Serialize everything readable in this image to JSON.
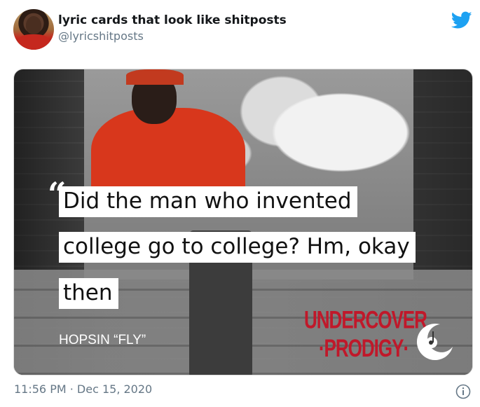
{
  "tweet": {
    "display_name": "lyric cards that look like shitposts",
    "handle": "@lyricshitposts",
    "timestamp": "11:56 PM · Dec 15, 2020",
    "brand_color": "#1da1f2"
  },
  "card": {
    "quote_mark": "“",
    "quote_lines": [
      "Did the man who invented",
      "college go to college? Hm, okay",
      "then"
    ],
    "credit": "HOPSIN “FLY”",
    "brand_line1": "UNDERCOVER",
    "brand_line2": "·PRODIGY·",
    "brand_color": "#c0182a"
  },
  "icons": {
    "logo": "twitter-bird-icon",
    "info": "info-icon",
    "moon": "moon-note-icon"
  }
}
